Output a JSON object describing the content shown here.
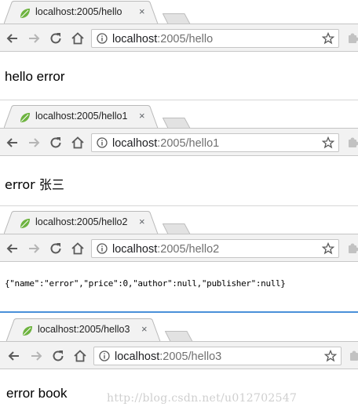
{
  "windows": [
    {
      "tab_title": "localhost:2005/hello",
      "url_host": "localhost",
      "url_rest": ":2005/hello",
      "body_text": "hello error",
      "body_style": "plain"
    },
    {
      "tab_title": "localhost:2005/hello1",
      "url_host": "localhost",
      "url_rest": ":2005/hello1",
      "body_text": "error 张三",
      "body_style": "plain"
    },
    {
      "tab_title": "localhost:2005/hello2",
      "url_host": "localhost",
      "url_rest": ":2005/hello2",
      "body_text": "{\"name\":\"error\",\"price\":0,\"author\":null,\"publisher\":null}",
      "body_style": "mono"
    },
    {
      "tab_title": "localhost:2005/hello3",
      "url_host": "localhost",
      "url_rest": ":2005/hello3",
      "body_text": "error book",
      "body_style": "plain"
    }
  ],
  "tab_close_glyph": "×",
  "watermark": "http://blog.csdn.net/u012702547",
  "colors": {
    "favicon_green": "#6db33f",
    "toolbar_bg": "#f2f2f2",
    "tab_border": "#b9b9b9"
  },
  "icons": [
    "favicon-leaf-icon",
    "back-arrow-icon",
    "forward-arrow-icon",
    "reload-icon",
    "home-icon",
    "info-icon",
    "bookmark-star-icon",
    "extension-icon",
    "close-icon"
  ]
}
